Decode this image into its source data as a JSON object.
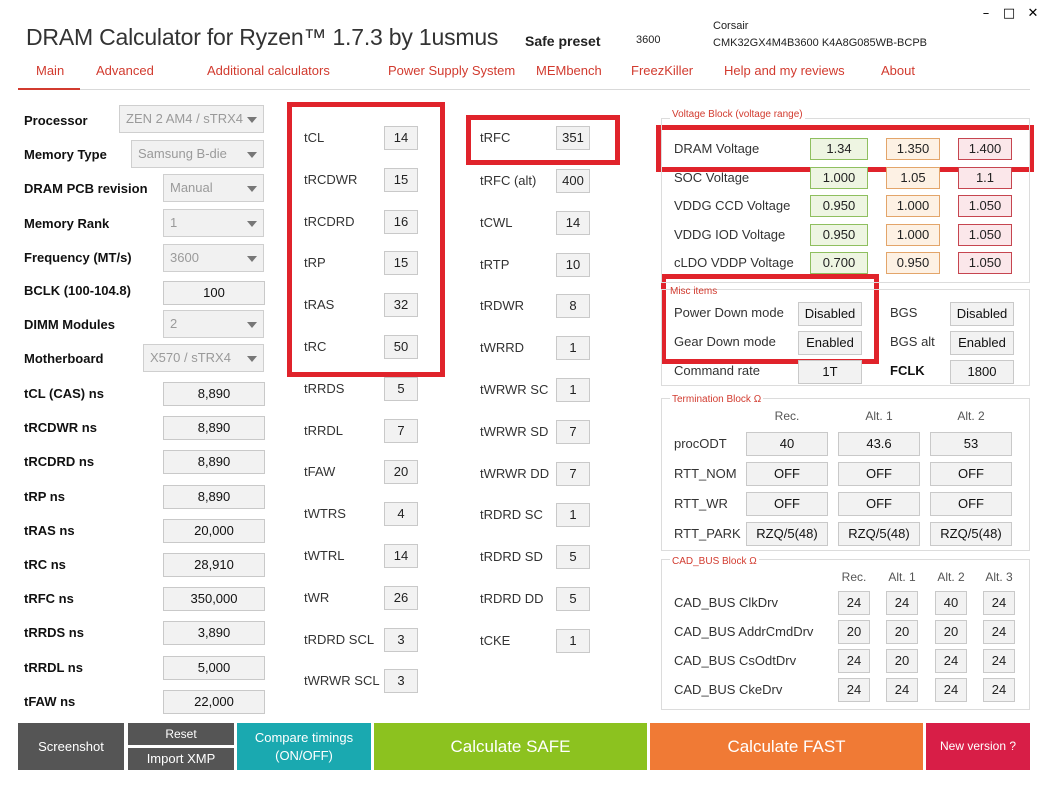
{
  "app": {
    "title": "DRAM Calculator for Ryzen™ 1.7.3 by 1usmus",
    "preset_label": "Safe preset",
    "preset_value": "3600",
    "module_brand": "Corsair",
    "module_part": "CMK32GX4M4B3600 K4A8G085WB-BCPB",
    "window_controls": {
      "minimize": "–",
      "maximize": "□",
      "close": "✕"
    }
  },
  "menu": [
    "Main",
    "Advanced",
    "Additional calculators",
    "Power Supply System",
    "MEMbench",
    "FreezKiller",
    "Help and my reviews",
    "About"
  ],
  "left_selects": [
    {
      "label": "Processor",
      "value": "ZEN 2 AM4 / sTRX4"
    },
    {
      "label": "Memory Type",
      "value": "Samsung B-die"
    },
    {
      "label": "DRAM PCB revision",
      "value": "Manual"
    },
    {
      "label": "Memory Rank",
      "value": "1"
    },
    {
      "label": "Frequency (MT/s)",
      "value": "3600"
    },
    {
      "label": "BCLK (100-104.8)",
      "value": "100"
    },
    {
      "label": "DIMM Modules",
      "value": "2"
    },
    {
      "label": "Motherboard",
      "value": "X570 / sTRX4"
    }
  ],
  "left_ns": [
    {
      "label": "tCL (CAS) ns",
      "value": "8,890"
    },
    {
      "label": "tRCDWR ns",
      "value": "8,890"
    },
    {
      "label": "tRCDRD ns",
      "value": "8,890"
    },
    {
      "label": "tRP ns",
      "value": "8,890"
    },
    {
      "label": "tRAS ns",
      "value": "20,000"
    },
    {
      "label": "tRC ns",
      "value": "28,910"
    },
    {
      "label": "tRFC ns",
      "value": "350,000"
    },
    {
      "label": "tRRDS ns",
      "value": "3,890"
    },
    {
      "label": "tRRDL ns",
      "value": "5,000"
    },
    {
      "label": "tFAW ns",
      "value": "22,000"
    }
  ],
  "timings_col1": [
    {
      "label": "tCL",
      "value": "14"
    },
    {
      "label": "tRCDWR",
      "value": "15"
    },
    {
      "label": "tRCDRD",
      "value": "16"
    },
    {
      "label": "tRP",
      "value": "15"
    },
    {
      "label": "tRAS",
      "value": "32"
    },
    {
      "label": "tRC",
      "value": "50"
    },
    {
      "label": "tRRDS",
      "value": "5"
    },
    {
      "label": "tRRDL",
      "value": "7"
    },
    {
      "label": "tFAW",
      "value": "20"
    },
    {
      "label": "tWTRS",
      "value": "4"
    },
    {
      "label": "tWTRL",
      "value": "14"
    },
    {
      "label": "tWR",
      "value": "26"
    },
    {
      "label": "tRDRD SCL",
      "value": "3"
    },
    {
      "label": "tWRWR SCL",
      "value": "3"
    }
  ],
  "timings_col2": [
    {
      "label": "tRFC",
      "value": "351"
    },
    {
      "label": "tRFC (alt)",
      "value": "400"
    },
    {
      "label": "tCWL",
      "value": "14"
    },
    {
      "label": "tRTP",
      "value": "10"
    },
    {
      "label": "tRDWR",
      "value": "8"
    },
    {
      "label": "tWRRD",
      "value": "1"
    },
    {
      "label": "tWRWR SC",
      "value": "1"
    },
    {
      "label": "tWRWR SD",
      "value": "7"
    },
    {
      "label": "tWRWR DD",
      "value": "7"
    },
    {
      "label": "tRDRD SC",
      "value": "1"
    },
    {
      "label": "tRDRD SD",
      "value": "5"
    },
    {
      "label": "tRDRD DD",
      "value": "5"
    },
    {
      "label": "tCKE",
      "value": "1"
    }
  ],
  "voltage": {
    "title": "Voltage Block (voltage range)",
    "rows": [
      {
        "label": "DRAM Voltage",
        "min": "1.34",
        "rec": "1.350",
        "max": "1.400"
      },
      {
        "label": "SOC Voltage",
        "min": "1.000",
        "rec": "1.05",
        "max": "1.1"
      },
      {
        "label": "VDDG  CCD Voltage",
        "min": "0.950",
        "rec": "1.000",
        "max": "1.050"
      },
      {
        "label": "VDDG  IOD Voltage",
        "min": "0.950",
        "rec": "1.000",
        "max": "1.050"
      },
      {
        "label": "cLDO VDDP Voltage",
        "min": "0.700",
        "rec": "0.950",
        "max": "1.050"
      }
    ]
  },
  "misc": {
    "title": "Misc items",
    "power_down_label": "Power Down mode",
    "power_down_value": "Disabled",
    "gear_down_label": "Gear Down mode",
    "gear_down_value": "Enabled",
    "command_rate_label": "Command rate",
    "command_rate_value": "1T",
    "bgs_label": "BGS",
    "bgs_value": "Disabled",
    "bgs_alt_label": "BGS alt",
    "bgs_alt_value": "Enabled",
    "fclk_label": "FCLK",
    "fclk_value": "1800"
  },
  "termination": {
    "title": "Termination Block Ω",
    "headers": [
      "Rec.",
      "Alt. 1",
      "Alt. 2"
    ],
    "rows": [
      {
        "label": "procODT",
        "values": [
          "40",
          "43.6",
          "53"
        ]
      },
      {
        "label": "RTT_NOM",
        "values": [
          "OFF",
          "OFF",
          "OFF"
        ]
      },
      {
        "label": "RTT_WR",
        "values": [
          "OFF",
          "OFF",
          "OFF"
        ]
      },
      {
        "label": "RTT_PARK",
        "values": [
          "RZQ/5(48)",
          "RZQ/5(48)",
          "RZQ/5(48)"
        ]
      }
    ]
  },
  "cad_bus": {
    "title": "CAD_BUS Block Ω",
    "headers": [
      "Rec.",
      "Alt. 1",
      "Alt. 2",
      "Alt. 3"
    ],
    "rows": [
      {
        "label": "CAD_BUS ClkDrv",
        "values": [
          "24",
          "24",
          "40",
          "24"
        ]
      },
      {
        "label": "CAD_BUS AddrCmdDrv",
        "values": [
          "20",
          "20",
          "20",
          "24"
        ]
      },
      {
        "label": "CAD_BUS CsOdtDrv",
        "values": [
          "24",
          "20",
          "24",
          "24"
        ]
      },
      {
        "label": "CAD_BUS CkeDrv",
        "values": [
          "24",
          "24",
          "24",
          "24"
        ]
      }
    ]
  },
  "bottom": {
    "screenshot": "Screenshot",
    "reset": "Reset",
    "import_xmp": "Import XMP",
    "compare_line1": "Compare timings",
    "compare_line2": "(ON/OFF)",
    "calc_safe": "Calculate SAFE",
    "calc_fast": "Calculate FAST",
    "new_version": "New version ?"
  },
  "colors": {
    "accent_red": "#d23b2f",
    "highlight_red": "#e0232b",
    "btn_dark": "#555555",
    "btn_teal": "#1aa9b0",
    "btn_green": "#8cc21f",
    "btn_orange": "#f07a35",
    "btn_crimson": "#d81e47"
  }
}
